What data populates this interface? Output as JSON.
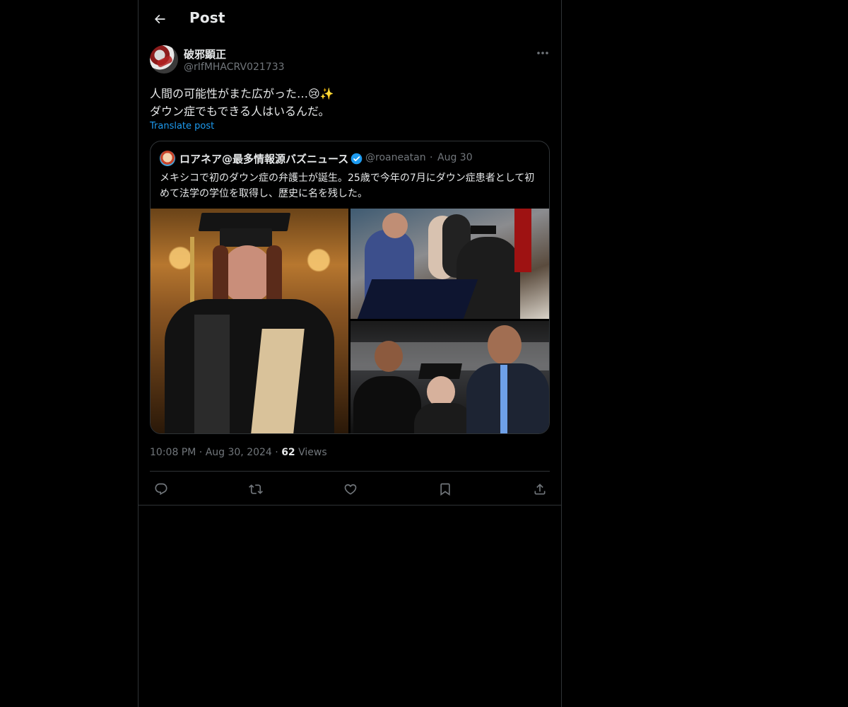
{
  "header": {
    "title": "Post"
  },
  "post": {
    "author_name": "破邪顕正",
    "author_handle": "@rIfMHACRV021733",
    "text_line1": "人間の可能性がまた広がった…😢✨",
    "text_line2": "ダウン症でもできる人はいるんだ。",
    "translate_label": "Translate post",
    "time": "10:08 PM",
    "date": "Aug 30, 2024",
    "views_count": "62",
    "views_label": "Views"
  },
  "quote": {
    "author_name": "ロアネア@最多情報源バズニュース",
    "author_handle": "@roaneatan",
    "date": "Aug 30",
    "text": "メキシコで初のダウン症の弁護士が誕生。25歳で今年の7月にダウン症患者として初めて法学の学位を取得し、歴史に名を残した。"
  },
  "colors": {
    "background": "#000000",
    "text": "#e7e9ea",
    "secondary": "#71767b",
    "link": "#1d9bf0",
    "border": "#2f3336"
  }
}
